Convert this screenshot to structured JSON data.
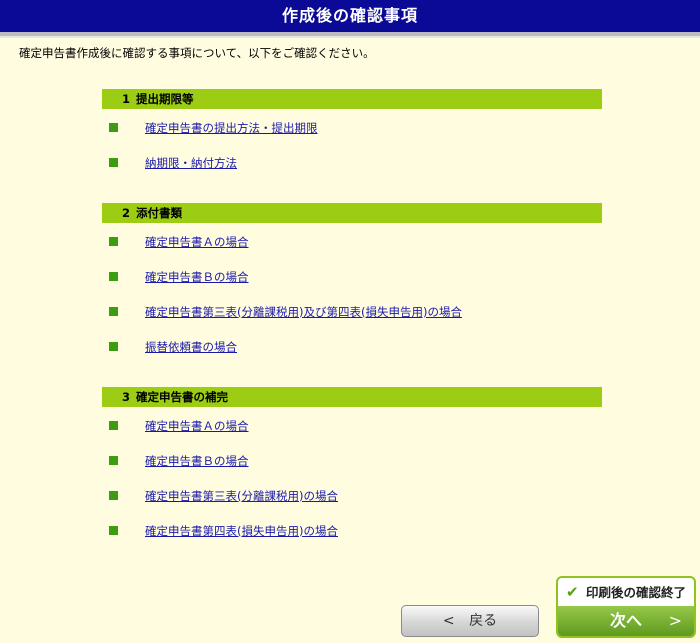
{
  "header": {
    "title": "作成後の確認事項"
  },
  "intro": "確定申告書作成後に確認する事項について、以下をご確認ください。",
  "sections": [
    {
      "number": "1",
      "title": "提出期限等",
      "items": [
        "確定申告書の提出方法・提出期限",
        "納期限・納付方法"
      ]
    },
    {
      "number": "2",
      "title": "添付書類",
      "items": [
        "確定申告書Ａの場合",
        "確定申告書Ｂの場合",
        "確定申告書第三表(分離課税用)及び第四表(損失申告用)の場合",
        "振替依頼書の場合"
      ]
    },
    {
      "number": "3",
      "title": "確定申告書の補完",
      "items": [
        "確定申告書Ａの場合",
        "確定申告書Ｂの場合",
        "確定申告書第三表(分離課税用)の場合",
        "確定申告書第四表(損失申告用)の場合"
      ]
    }
  ],
  "footer": {
    "back_chevron": "<",
    "back_label": "戻る",
    "finish_label": "印刷後の確認終了",
    "next_label": "次へ",
    "next_chevron": ">"
  },
  "colors": {
    "title_bar": "#0a0a96",
    "background": "#fffce0",
    "section_header": "#9ccc14",
    "bullet": "#3c9c14",
    "link": "#1a1aaa",
    "next_button": "#6fa82a"
  }
}
